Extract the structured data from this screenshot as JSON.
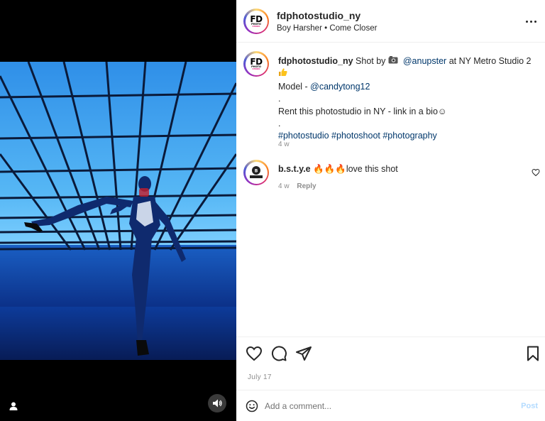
{
  "post": {
    "username": "fdphotostudio_ny",
    "audio": "Boy Harsher • Come Closer",
    "avatar_logo": {
      "main": "FD",
      "line1": "PHOTO",
      "line2": "STUDIO"
    }
  },
  "caption": {
    "username": "fdphotostudio_ny",
    "shot_by": "Shot by",
    "photographer": "@anupster",
    "location": "at NY Metro Studio 2",
    "model_label": "Model - ",
    "model": "@candytong12",
    "dot1": ".",
    "rent": "Rent this photostudio in NY - link in a bio☺",
    "dot2": ".",
    "hashtags": "#photostudio #photoshoot #photography",
    "time": "4 w"
  },
  "comment": {
    "username": "b.s.t.y.e",
    "flames": "🔥🔥🔥",
    "text": "love this shot",
    "time": "4 w",
    "reply": "Reply",
    "avatar_logo": "B.S.T.Y.E"
  },
  "date": "July 17",
  "add_comment": {
    "placeholder": "Add a comment...",
    "post_label": "Post"
  },
  "icons": {
    "more": "more-icon",
    "like": "heart-icon",
    "comment": "comment-icon",
    "share": "send-icon",
    "save": "bookmark-icon",
    "emoji": "smiley-icon",
    "tag": "user-tag-icon",
    "sound": "speaker-icon"
  },
  "colors": {
    "link": "#00376b",
    "photo_blue": "#1e7fe0",
    "muted": "#8e8e8e"
  }
}
